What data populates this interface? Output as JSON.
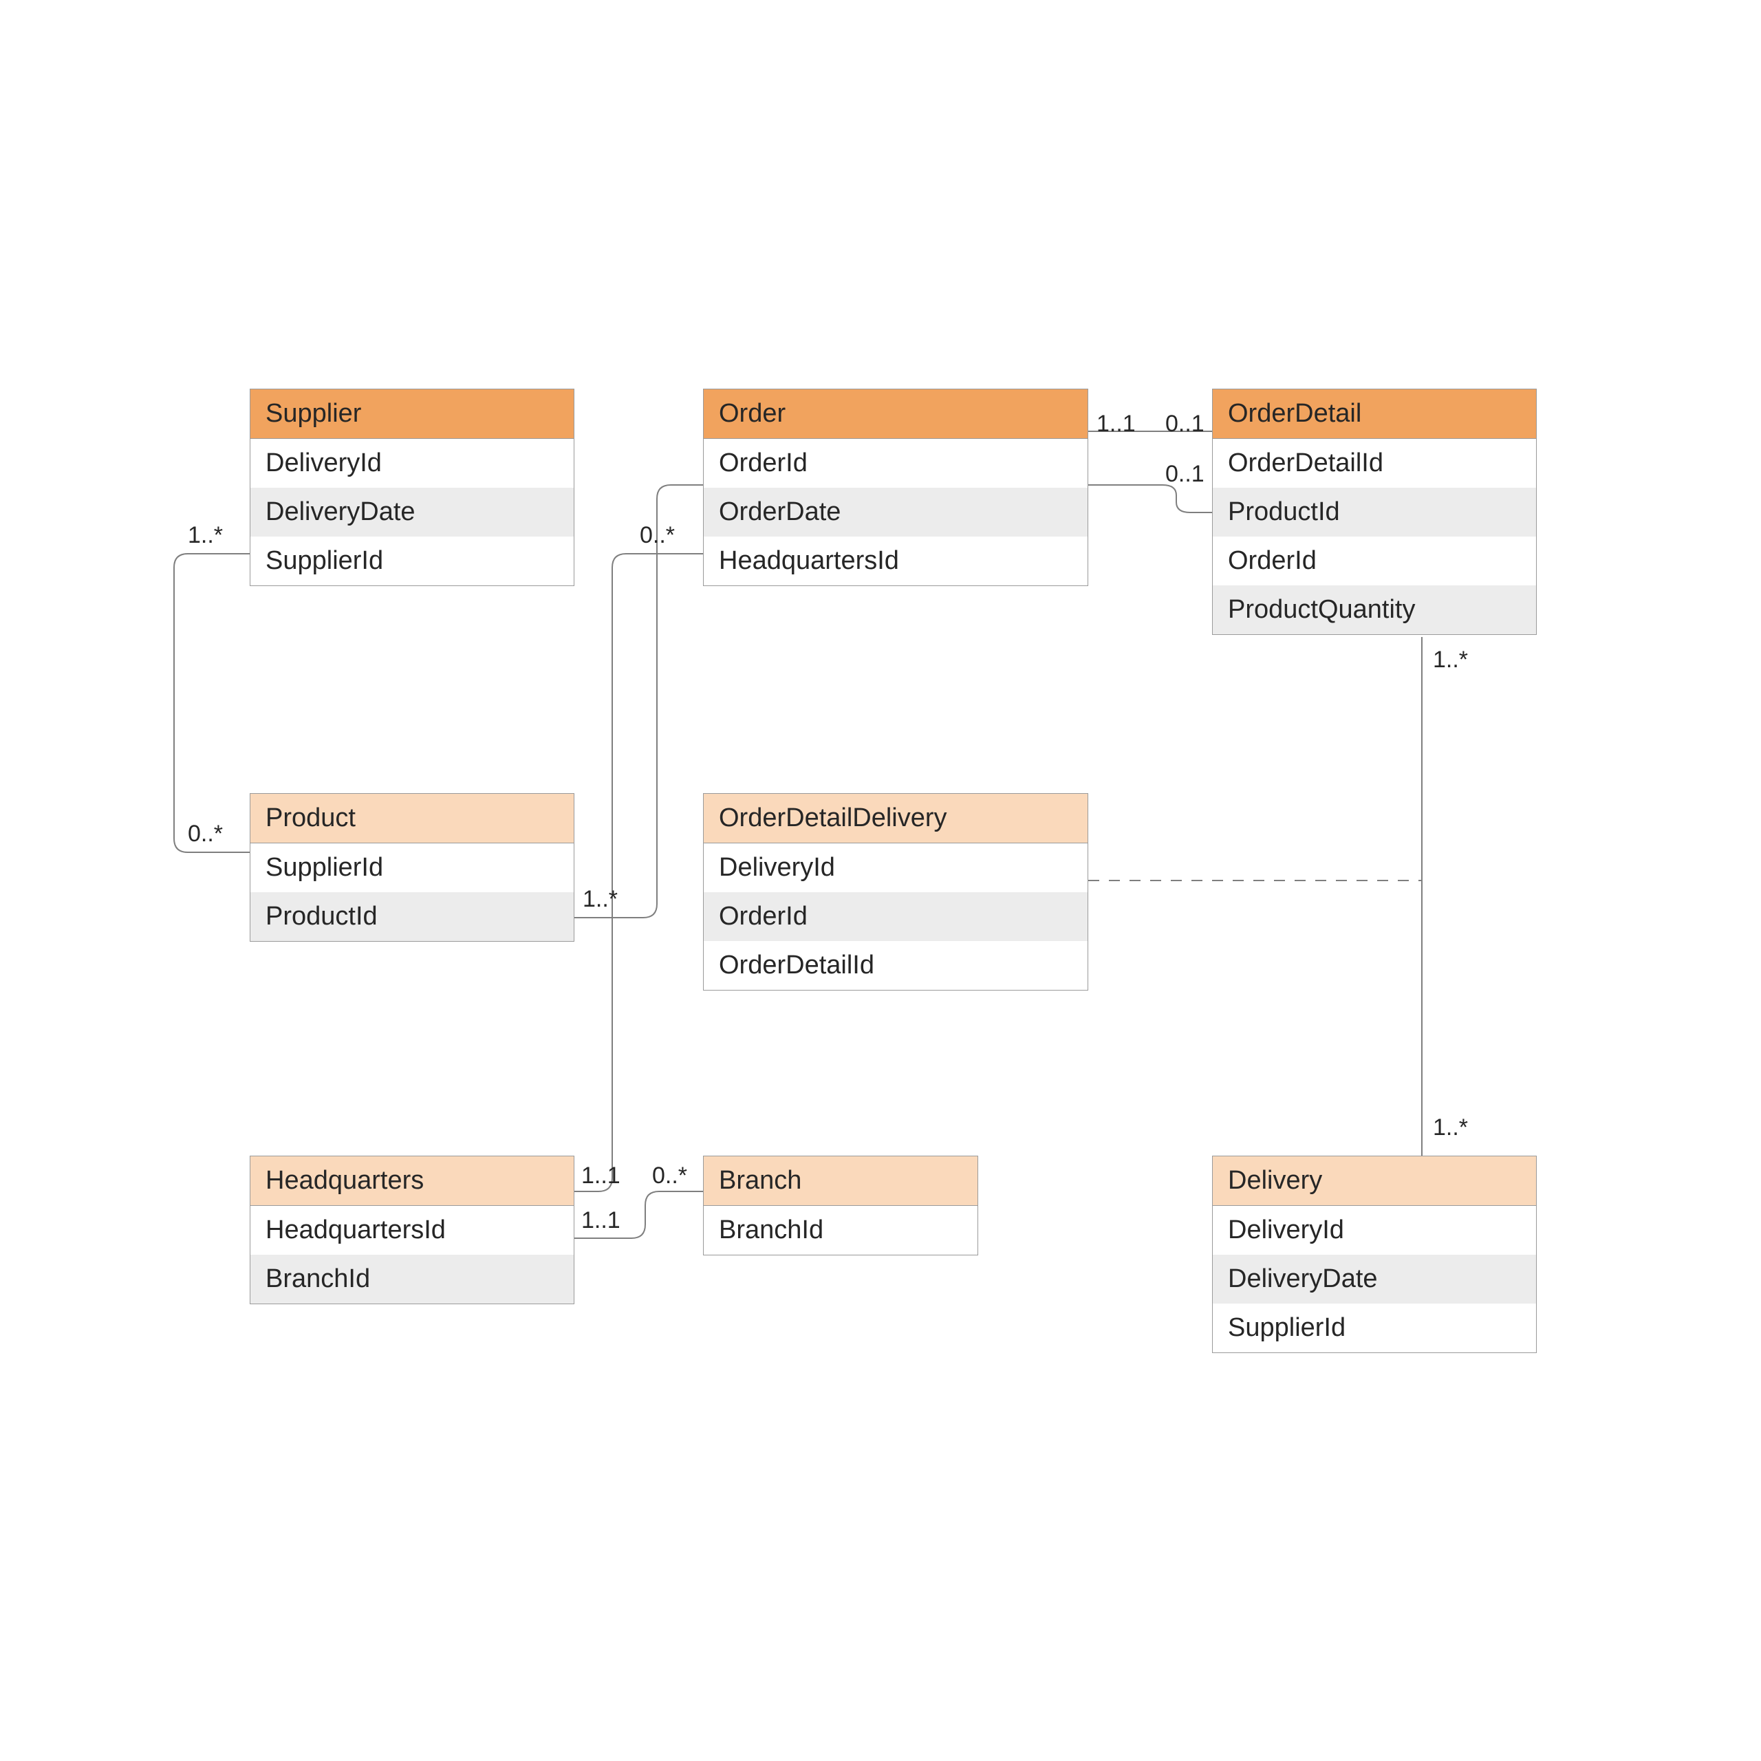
{
  "entities": {
    "supplier": {
      "title": "Supplier",
      "fields": [
        "DeliveryId",
        "DeliveryDate",
        "SupplierId"
      ]
    },
    "order": {
      "title": "Order",
      "fields": [
        "OrderId",
        "OrderDate",
        "HeadquartersId"
      ]
    },
    "orderDetail": {
      "title": "OrderDetail",
      "fields": [
        "OrderDetailId",
        "ProductId",
        "OrderId",
        "ProductQuantity"
      ]
    },
    "product": {
      "title": "Product",
      "fields": [
        "SupplierId",
        "ProductId"
      ]
    },
    "orderDetailDelivery": {
      "title": "OrderDetailDelivery",
      "fields": [
        "DeliveryId",
        "OrderId",
        "OrderDetailId"
      ]
    },
    "headquarters": {
      "title": "Headquarters",
      "fields": [
        "HeadquartersId",
        "BranchId"
      ]
    },
    "branch": {
      "title": "Branch",
      "fields": [
        "BranchId"
      ]
    },
    "delivery": {
      "title": "Delivery",
      "fields": [
        "DeliveryId",
        "DeliveryDate",
        "SupplierId"
      ]
    }
  },
  "labels": {
    "supplier_left": "1..*",
    "product_left": "0..*",
    "product_right": "1..*",
    "order_left": "0..*",
    "order_right": "1..1",
    "orderDetail_left_top": "0..1",
    "orderDetail_left_bot": "0..1",
    "orderDetail_bottom": "1..*",
    "delivery_top": "1..*",
    "hq_right_top": "1..1",
    "hq_right_bot": "1..1",
    "branch_left": "0..*"
  }
}
